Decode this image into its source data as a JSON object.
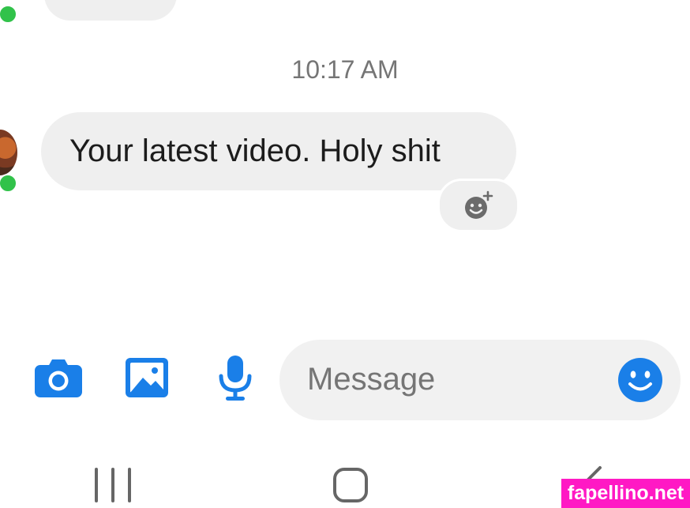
{
  "conversation": {
    "timestamp": "10:17 AM",
    "messages": [
      {
        "text": "Your latest video. Holy shit",
        "sender": "contact"
      }
    ]
  },
  "composer": {
    "placeholder": "Message",
    "icons": [
      "camera-icon",
      "gallery-icon",
      "microphone-icon",
      "emoji-icon"
    ]
  },
  "navigation": {
    "buttons": [
      "recent-apps",
      "home",
      "back"
    ]
  },
  "watermark": {
    "text": "fapellino.net"
  },
  "colors": {
    "accent": "#1a7fe8",
    "bubble": "#efefef",
    "presence": "#31c24a",
    "watermark_bg": "#ff19c4"
  }
}
